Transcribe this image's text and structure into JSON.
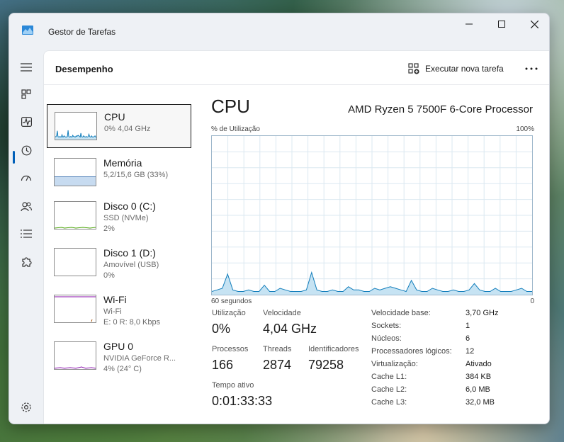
{
  "window": {
    "title": "Gestor de Tarefas"
  },
  "header": {
    "title": "Desempenho",
    "run_task_label": "Executar nova tarefa"
  },
  "sidebar": {
    "items": [
      {
        "name": "CPU",
        "line1": "0%  4,04 GHz",
        "line2": "",
        "color": "#117dbb"
      },
      {
        "name": "Memória",
        "line1": "5,2/15,6 GB (33%)",
        "line2": "",
        "color": "#8b12ae"
      },
      {
        "name": "Disco 0 (C:)",
        "line1": "SSD (NVMe)",
        "line2": "2%",
        "color": "#4da60c"
      },
      {
        "name": "Disco 1 (D:)",
        "line1": "Amovível (USB)",
        "line2": "0%",
        "color": "#4da60c"
      },
      {
        "name": "Wi-Fi",
        "line1": "Wi-Fi",
        "line2": "E: 0 R: 8,0 Kbps",
        "color": "#a74f01"
      },
      {
        "name": "GPU 0",
        "line1": "NVIDIA GeForce R...",
        "line2": "4% (24° C)",
        "color": "#8b12ae"
      }
    ]
  },
  "main": {
    "title": "CPU",
    "processor": "AMD Ryzen 5 7500F 6-Core Processor",
    "graph_label": "% de Utilização",
    "graph_max": "100%",
    "axis_left": "60 segundos",
    "axis_right": "0",
    "stats": {
      "util_label": "Utilização",
      "util_value": "0%",
      "speed_label": "Velocidade",
      "speed_value": "4,04 GHz",
      "proc_label": "Processos",
      "proc_value": "166",
      "threads_label": "Threads",
      "threads_value": "2874",
      "handles_label": "Identificadores",
      "handles_value": "79258",
      "uptime_label": "Tempo ativo",
      "uptime_value": "0:01:33:33"
    },
    "specs": [
      {
        "label": "Velocidade base:",
        "value": "3,70 GHz"
      },
      {
        "label": "Sockets:",
        "value": "1"
      },
      {
        "label": "Núcleos:",
        "value": "6"
      },
      {
        "label": "Processadores lógicos:",
        "value": "12"
      },
      {
        "label": "Virtualização:",
        "value": "Ativado"
      },
      {
        "label": "Cache L1:",
        "value": "384 KB"
      },
      {
        "label": "Cache L2:",
        "value": "6,0 MB"
      },
      {
        "label": "Cache L3:",
        "value": "32,0 MB"
      }
    ]
  },
  "cpu_history": [
    2,
    3,
    4,
    13,
    3,
    2,
    2,
    3,
    2,
    2,
    6,
    2,
    2,
    4,
    3,
    2,
    2,
    2,
    3,
    14,
    3,
    2,
    2,
    3,
    2,
    2,
    5,
    3,
    3,
    2,
    2,
    4,
    3,
    4,
    5,
    4,
    3,
    2,
    9,
    3,
    2,
    2,
    4,
    3,
    2,
    2,
    3,
    2,
    2,
    3,
    7,
    3,
    2,
    2,
    4,
    2,
    2,
    2,
    3,
    4,
    2,
    2
  ],
  "theme": {
    "accent": "#005fb8",
    "cpu_line": "#117dbb",
    "cpu_fill": "#c6e3f3",
    "grid": "#dbe8f1"
  }
}
